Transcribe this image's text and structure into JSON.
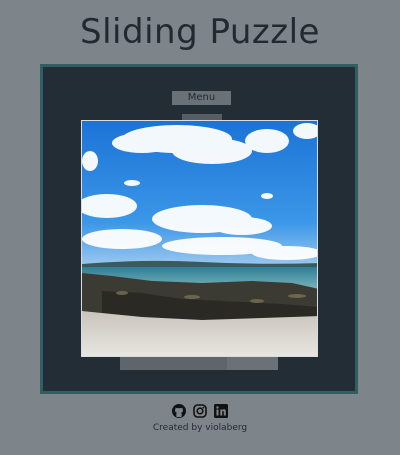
{
  "page": {
    "title": "Sliding Puzzle"
  },
  "board": {
    "menu_label": "Menu",
    "puzzle_image": "beach-scene"
  },
  "footer": {
    "icons": [
      "github-icon",
      "instagram-icon",
      "linkedin-icon"
    ],
    "credit": "Created by violaberg"
  },
  "colors": {
    "background": "#7d858b",
    "board": "#222d35",
    "board_border": "#2f5e63",
    "text": "#1f2a31"
  }
}
